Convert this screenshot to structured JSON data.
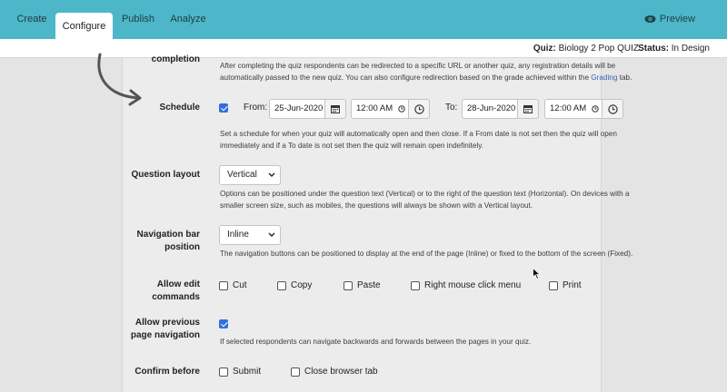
{
  "nav": {
    "tabs": [
      {
        "label": "Create"
      },
      {
        "label": "Configure",
        "active": true
      },
      {
        "label": "Publish"
      },
      {
        "label": "Analyze"
      }
    ],
    "preview_label": "Preview"
  },
  "info": {
    "quiz_label": "Quiz:",
    "quiz_name": "Biology 2 Pop QUIZ",
    "status_label": "Status:",
    "status_value": "In Design"
  },
  "completion": {
    "label": "completion",
    "help_line1": "After completing the quiz respondents can be redirected to a specific URL or another quiz, any registration details will be",
    "help_line2a": "automatically passed to the new quiz. You can also configure redirection based on the grade achieved within the",
    "help_link": "Grading",
    "help_line2b": "tab."
  },
  "schedule": {
    "label": "Schedule",
    "checked": true,
    "from_label": "From:",
    "from_date": "25-Jun-2020",
    "from_time": "12:00 AM",
    "to_label": "To:",
    "to_date": "28-Jun-2020",
    "to_time": "12:00 AM",
    "help_line1": "Set a schedule for when your quiz will automatically open and then close. If a From date is not set then the quiz will open",
    "help_line2": "immediately and if a To date is not set then the quiz will remain open indefinitely."
  },
  "question_layout": {
    "label": "Question layout",
    "value": "Vertical",
    "help_line1": "Options can be positioned under the question text (Vertical) or to the right of the question text (Horizontal). On devices with a",
    "help_line2": "smaller screen size, such as mobiles, the questions will always be shown with a Vertical layout."
  },
  "nav_bar_position": {
    "label_line1": "Navigation bar",
    "label_line2": "position",
    "value": "Inline",
    "help": "The navigation buttons can be positioned to display at the end of the page (Inline) or fixed to the bottom of the screen (Fixed)."
  },
  "allow_edit": {
    "label_line1": "Allow edit",
    "label_line2": "commands",
    "options": [
      {
        "label": "Cut",
        "checked": false
      },
      {
        "label": "Copy",
        "checked": false
      },
      {
        "label": "Paste",
        "checked": false
      },
      {
        "label": "Right mouse click menu",
        "checked": false
      },
      {
        "label": "Print",
        "checked": false
      }
    ]
  },
  "allow_previous": {
    "label_line1": "Allow previous",
    "label_line2": "page navigation",
    "checked": true,
    "help": "If selected respondents can navigate backwards and forwards between the pages in your quiz."
  },
  "confirm_before": {
    "label": "Confirm before",
    "options": [
      {
        "label": "Submit",
        "checked": false
      },
      {
        "label": "Close browser tab",
        "checked": false
      }
    ]
  },
  "colors": {
    "nav_bg": "#4db6c8",
    "accent_checkbox": "#2f6fde",
    "link": "#3b63b8"
  }
}
